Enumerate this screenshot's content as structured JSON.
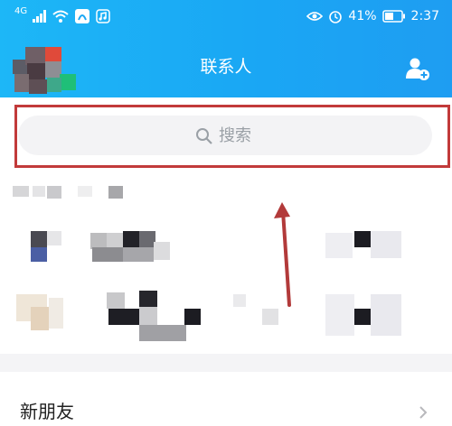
{
  "status_bar": {
    "network": "4G",
    "battery_percent": "41%",
    "time": "2:37",
    "icons": [
      "signal-icon",
      "wifi-icon",
      "app-icon",
      "music-icon",
      "eye-icon",
      "alarm-icon",
      "battery-icon"
    ]
  },
  "header": {
    "title": "联系人",
    "add_contact_icon": "add-contact-icon"
  },
  "search": {
    "placeholder": "搜索",
    "icon": "search-icon"
  },
  "new_friends": {
    "label": "新朋友"
  },
  "colors": {
    "header_gradient_start": "#1db7f7",
    "header_gradient_end": "#1e9df2",
    "annotation_red": "#c23a3a"
  }
}
